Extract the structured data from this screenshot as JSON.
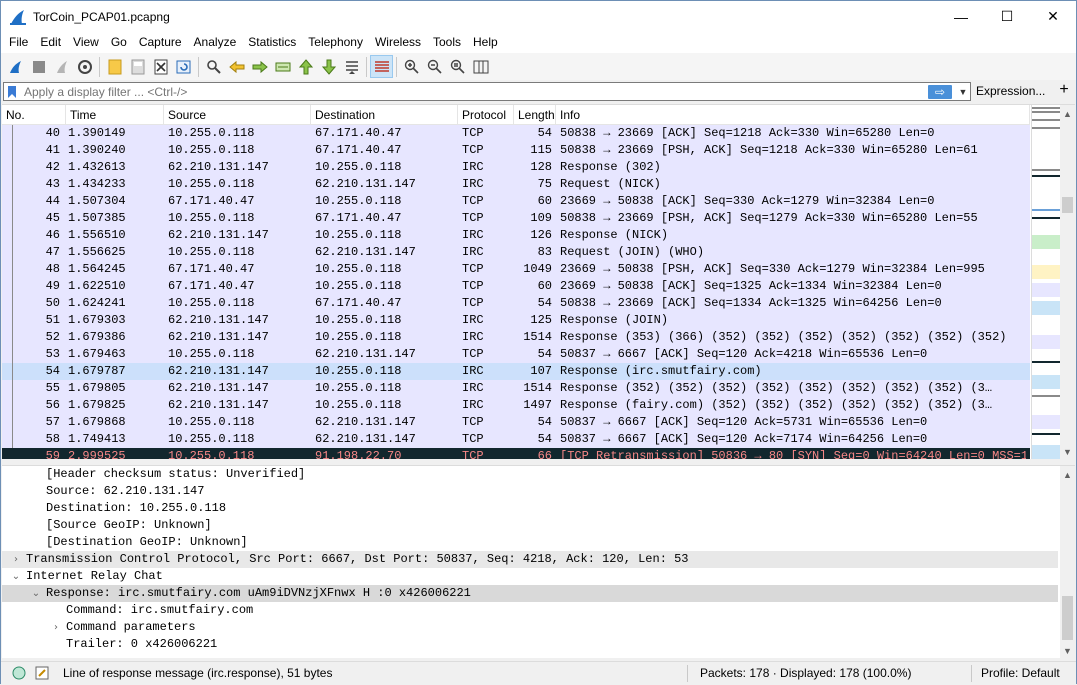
{
  "window": {
    "title": "TorCoin_PCAP01.pcapng",
    "minimize": "—",
    "maximize": "☐",
    "close": "✕"
  },
  "menu": [
    {
      "label": "File",
      "u": "F",
      "rest": "ile"
    },
    {
      "label": "Edit",
      "u": "E",
      "rest": "dit"
    },
    {
      "label": "View",
      "u": "V",
      "rest": "iew"
    },
    {
      "label": "Go",
      "u": "G",
      "rest": "o"
    },
    {
      "label": "Capture",
      "u": "C",
      "rest": "apture"
    },
    {
      "label": "Analyze",
      "u": "A",
      "rest": "nalyze"
    },
    {
      "label": "Statistics",
      "u": "S",
      "rest": "tatistics"
    },
    {
      "label": "Telephony",
      "u": "",
      "rest": "Telephony"
    },
    {
      "label": "Wireless",
      "u": "W",
      "rest": "ireless"
    },
    {
      "label": "Tools",
      "u": "T",
      "rest": "ools"
    },
    {
      "label": "Help",
      "u": "H",
      "rest": "elp"
    }
  ],
  "filter": {
    "placeholder": "Apply a display filter ... <Ctrl-/>",
    "expression_label": "Expression...",
    "plus_label": "+"
  },
  "packet_list": {
    "columns": [
      "No.",
      "Time",
      "Source",
      "Destination",
      "Protocol",
      "Length",
      "Info"
    ],
    "rows": [
      {
        "no": "40",
        "time": "1.390149",
        "src": "10.255.0.118",
        "dst": "67.171.40.47",
        "proto": "TCP",
        "len": "54",
        "info": "50838 → 23669 [ACK] Seq=1218 Ack=330 Win=65280 Len=0"
      },
      {
        "no": "41",
        "time": "1.390240",
        "src": "10.255.0.118",
        "dst": "67.171.40.47",
        "proto": "TCP",
        "len": "115",
        "info": "50838 → 23669 [PSH, ACK] Seq=1218 Ack=330 Win=65280 Len=61"
      },
      {
        "no": "42",
        "time": "1.432613",
        "src": "62.210.131.147",
        "dst": "10.255.0.118",
        "proto": "IRC",
        "len": "128",
        "info": "Response (302)"
      },
      {
        "no": "43",
        "time": "1.434233",
        "src": "10.255.0.118",
        "dst": "62.210.131.147",
        "proto": "IRC",
        "len": "75",
        "info": "Request (NICK)"
      },
      {
        "no": "44",
        "time": "1.507304",
        "src": "67.171.40.47",
        "dst": "10.255.0.118",
        "proto": "TCP",
        "len": "60",
        "info": "23669 → 50838 [ACK] Seq=330 Ack=1279 Win=32384 Len=0"
      },
      {
        "no": "45",
        "time": "1.507385",
        "src": "10.255.0.118",
        "dst": "67.171.40.47",
        "proto": "TCP",
        "len": "109",
        "info": "50838 → 23669 [PSH, ACK] Seq=1279 Ack=330 Win=65280 Len=55"
      },
      {
        "no": "46",
        "time": "1.556510",
        "src": "62.210.131.147",
        "dst": "10.255.0.118",
        "proto": "IRC",
        "len": "126",
        "info": "Response (NICK)"
      },
      {
        "no": "47",
        "time": "1.556625",
        "src": "10.255.0.118",
        "dst": "62.210.131.147",
        "proto": "IRC",
        "len": "83",
        "info": "Request (JOIN) (WHO)"
      },
      {
        "no": "48",
        "time": "1.564245",
        "src": "67.171.40.47",
        "dst": "10.255.0.118",
        "proto": "TCP",
        "len": "1049",
        "info": "23669 → 50838 [PSH, ACK] Seq=330 Ack=1279 Win=32384 Len=995"
      },
      {
        "no": "49",
        "time": "1.622510",
        "src": "67.171.40.47",
        "dst": "10.255.0.118",
        "proto": "TCP",
        "len": "60",
        "info": "23669 → 50838 [ACK] Seq=1325 Ack=1334 Win=32384 Len=0"
      },
      {
        "no": "50",
        "time": "1.624241",
        "src": "10.255.0.118",
        "dst": "67.171.40.47",
        "proto": "TCP",
        "len": "54",
        "info": "50838 → 23669 [ACK] Seq=1334 Ack=1325 Win=64256 Len=0"
      },
      {
        "no": "51",
        "time": "1.679303",
        "src": "62.210.131.147",
        "dst": "10.255.0.118",
        "proto": "IRC",
        "len": "125",
        "info": "Response (JOIN)"
      },
      {
        "no": "52",
        "time": "1.679386",
        "src": "62.210.131.147",
        "dst": "10.255.0.118",
        "proto": "IRC",
        "len": "1514",
        "info": "Response (353) (366) (352) (352) (352) (352) (352) (352) (352)"
      },
      {
        "no": "53",
        "time": "1.679463",
        "src": "10.255.0.118",
        "dst": "62.210.131.147",
        "proto": "TCP",
        "len": "54",
        "info": "50837 → 6667 [ACK] Seq=120 Ack=4218 Win=65536 Len=0"
      },
      {
        "no": "54",
        "time": "1.679787",
        "src": "62.210.131.147",
        "dst": "10.255.0.118",
        "proto": "IRC",
        "len": "107",
        "info": "Response (irc.smutfairy.com)",
        "selected": true
      },
      {
        "no": "55",
        "time": "1.679805",
        "src": "62.210.131.147",
        "dst": "10.255.0.118",
        "proto": "IRC",
        "len": "1514",
        "info": "Response (352) (352) (352) (352) (352) (352) (352) (352) (3…"
      },
      {
        "no": "56",
        "time": "1.679825",
        "src": "62.210.131.147",
        "dst": "10.255.0.118",
        "proto": "IRC",
        "len": "1497",
        "info": "Response (fairy.com) (352) (352) (352) (352) (352) (352) (3…"
      },
      {
        "no": "57",
        "time": "1.679868",
        "src": "10.255.0.118",
        "dst": "62.210.131.147",
        "proto": "TCP",
        "len": "54",
        "info": "50837 → 6667 [ACK] Seq=120 Ack=5731 Win=65536 Len=0"
      },
      {
        "no": "58",
        "time": "1.749413",
        "src": "10.255.0.118",
        "dst": "62.210.131.147",
        "proto": "TCP",
        "len": "54",
        "info": "50837 → 6667 [ACK] Seq=120 Ack=7174 Win=64256 Len=0"
      },
      {
        "no": "59",
        "time": "2.999525",
        "src": "10.255.0.118",
        "dst": "91.198.22.70",
        "proto": "TCP",
        "len": "66",
        "info": "[TCP Retransmission] 50836 → 80 [SYN] Seq=0 Win=64240 Len=0 MSS=1…",
        "bad": true
      }
    ]
  },
  "detail": [
    {
      "indent": 44,
      "exp": "",
      "text": "[Header checksum status: Unverified]"
    },
    {
      "indent": 44,
      "exp": "",
      "text": "Source: 62.210.131.147"
    },
    {
      "indent": 44,
      "exp": "",
      "text": "Destination: 10.255.0.118"
    },
    {
      "indent": 44,
      "exp": "",
      "text": "[Source GeoIP: Unknown]"
    },
    {
      "indent": 44,
      "exp": "",
      "text": "[Destination GeoIP: Unknown]"
    },
    {
      "indent": 24,
      "exp": ">",
      "text": "Transmission Control Protocol, Src Port: 6667, Dst Port: 50837, Seq: 4218, Ack: 120, Len: 53",
      "hl": true
    },
    {
      "indent": 24,
      "exp": "v",
      "text": "Internet Relay Chat"
    },
    {
      "indent": 44,
      "exp": "v",
      "text": "Response:  irc.smutfairy.com uAm9iDVNzjXFnwx H :0  x426006221",
      "sel": true
    },
    {
      "indent": 64,
      "exp": "",
      "text": "Command: irc.smutfairy.com"
    },
    {
      "indent": 64,
      "exp": ">",
      "text": "Command parameters"
    },
    {
      "indent": 64,
      "exp": "",
      "text": "Trailer: 0  x426006221"
    }
  ],
  "status": {
    "message": "Line of response message (irc.response), 51 bytes",
    "packets": "Packets: 178 · Displayed: 178 (100.0%)",
    "profile": "Profile: Default"
  },
  "colors": {
    "tcp_row": "#e7e6ff",
    "selected_row": "#cce0fb",
    "bad_row_bg": "#12272e",
    "bad_row_fg": "#f78787",
    "accent": "#4a90d9"
  }
}
